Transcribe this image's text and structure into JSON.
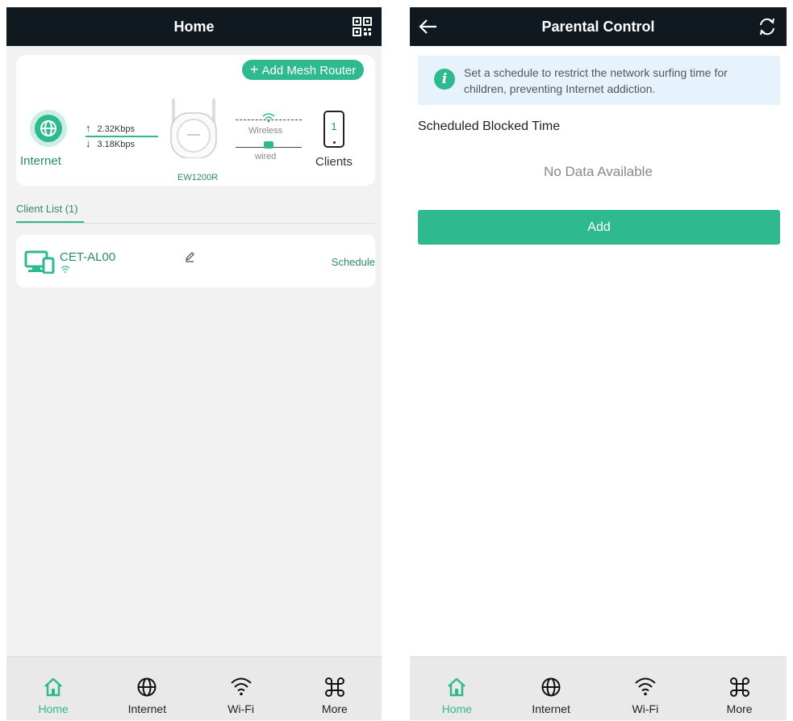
{
  "colors": {
    "accent": "#2fb98e",
    "topbar": "#101820",
    "info_bg": "#e6f3fd"
  },
  "left": {
    "header": {
      "title": "Home",
      "qr_icon": "qr-code-icon"
    },
    "card": {
      "add_mesh_label": "Add Mesh Router",
      "internet_label": "Internet",
      "upload_speed": "2.32Kbps",
      "download_speed": "3.18Kbps",
      "router_model": "EW1200R",
      "wireless_label": "Wireless",
      "wired_label": "wired",
      "client_count": "1",
      "clients_label": "Clients"
    },
    "client_list": {
      "tab_label": "Client List (1)",
      "items": [
        {
          "name": "CET-AL00",
          "action": "Schedule"
        }
      ]
    }
  },
  "right": {
    "header": {
      "title": "Parental Control"
    },
    "info": "Set a schedule to restrict the network surfing time for children, preventing Internet addiction.",
    "section_title": "Scheduled Blocked Time",
    "empty_text": "No Data Available",
    "add_label": "Add"
  },
  "nav": {
    "items": [
      {
        "label": "Home",
        "icon": "home-icon",
        "active": true
      },
      {
        "label": "Internet",
        "icon": "globe-icon",
        "active": false
      },
      {
        "label": "Wi-Fi",
        "icon": "wifi-icon",
        "active": false
      },
      {
        "label": "More",
        "icon": "command-icon",
        "active": false
      }
    ]
  }
}
